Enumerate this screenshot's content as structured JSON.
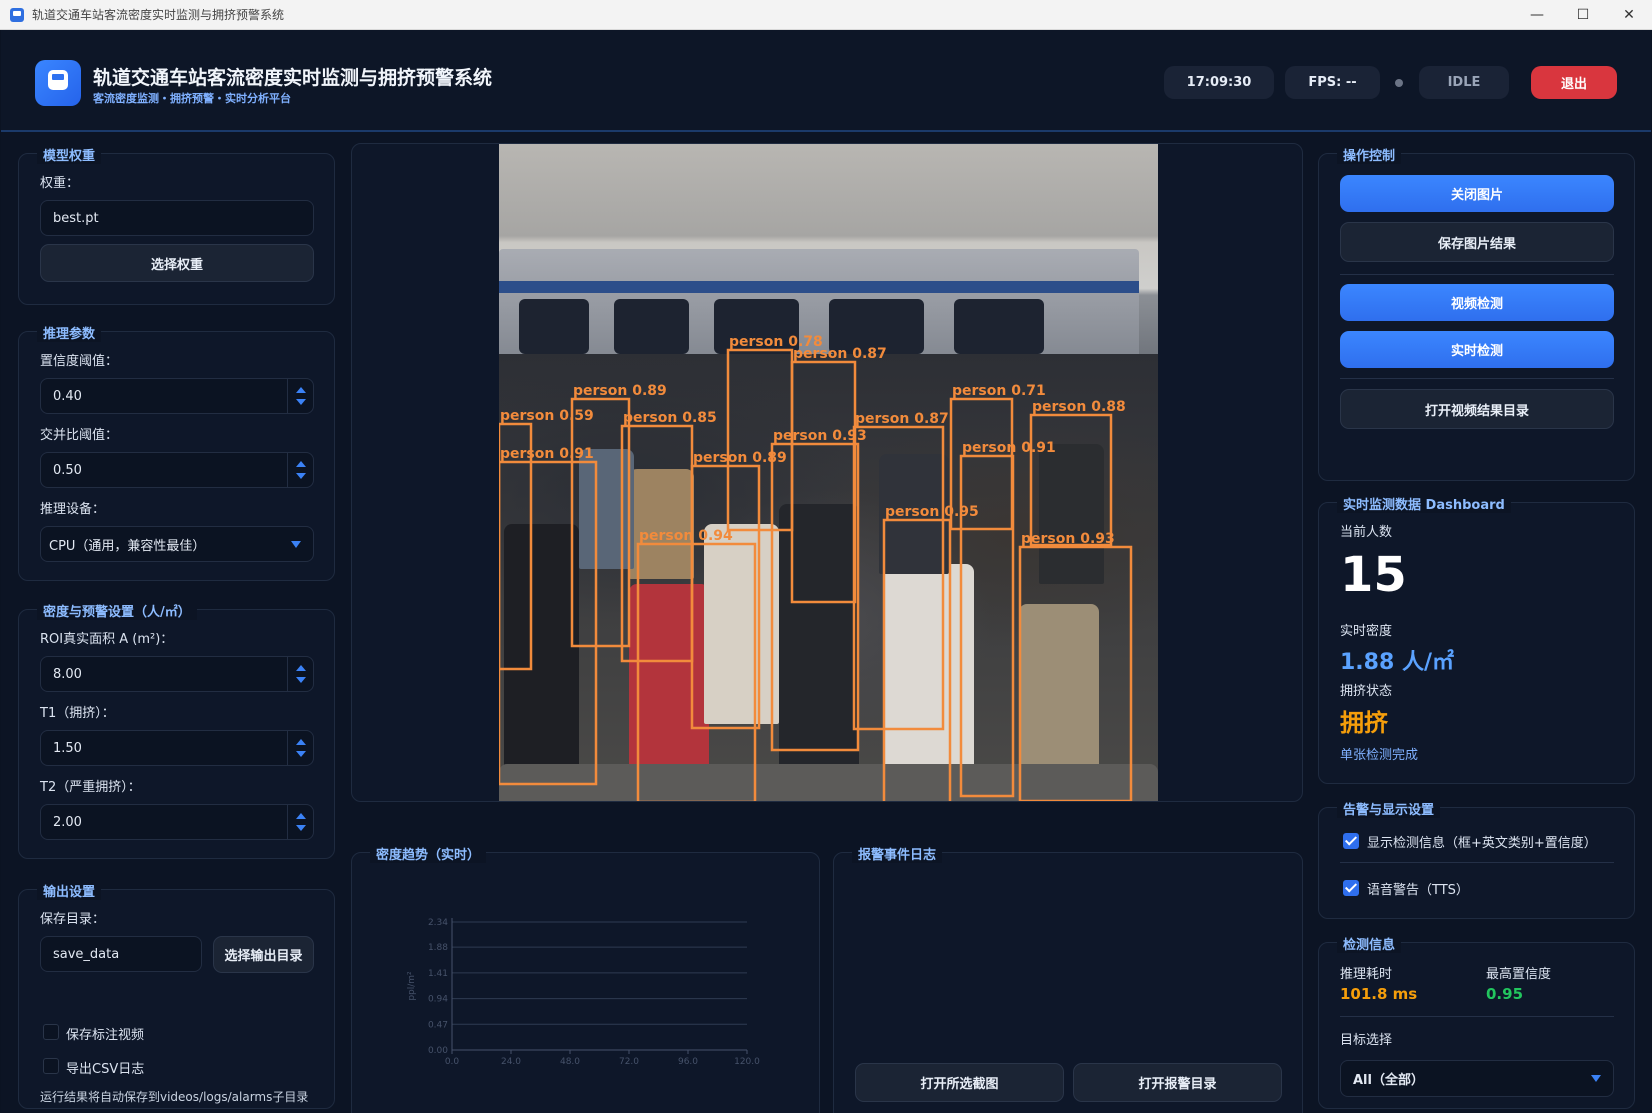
{
  "window": {
    "title": "轨道交通车站客流密度实时监测与拥挤预警系统"
  },
  "header": {
    "title": "轨道交通车站客流密度实时监测与拥挤预警系统",
    "subtitle": "客流密度监测・拥挤预警・实时分析平台",
    "time": "17:09:30",
    "fps": "FPS: --",
    "status": "IDLE",
    "exit_label": "退出"
  },
  "model": {
    "section": "模型权重",
    "weight_label": "权重：",
    "weight_value": "best.pt",
    "choose_label": "选择权重"
  },
  "inference": {
    "section": "推理参数",
    "conf_label": "置信度阈值：",
    "conf_value": "0.40",
    "iou_label": "交并比阈值：",
    "iou_value": "0.50",
    "device_label": "推理设备：",
    "device_value": "CPU（通用，兼容性最佳）"
  },
  "density": {
    "section": "密度与预警设置（人/㎡）",
    "roi_label": "ROI真实面积 A (m²)：",
    "roi_value": "8.00",
    "t1_label": "T1（拥挤）：",
    "t1_value": "1.50",
    "t2_label": "T2（严重拥挤）：",
    "t2_value": "2.00"
  },
  "output": {
    "section": "输出设置",
    "dir_label": "保存目录：",
    "dir_value": "save_data",
    "choose_dir_label": "选择输出目录",
    "save_video_label": "保存标注视频",
    "export_csv_label": "导出CSV日志",
    "note": "运行结果将自动保存到videos/logs/alarms子目录"
  },
  "detections": [
    {
      "label": "person 0.78"
    },
    {
      "label": "person 0.87"
    },
    {
      "label": "person 0.89"
    },
    {
      "label": "person 0.59"
    },
    {
      "label": "person 0.85"
    },
    {
      "label": "person 0.71"
    },
    {
      "label": "person 0.88"
    },
    {
      "label": "person 0.91"
    },
    {
      "label": "person 0.89"
    },
    {
      "label": "person 0.93"
    },
    {
      "label": "person 0.87"
    },
    {
      "label": "person 0.91"
    },
    {
      "label": "person 0.95"
    },
    {
      "label": "person 0.94"
    },
    {
      "label": "person 0.93"
    }
  ],
  "trend": {
    "section": "密度趋势（实时）",
    "chart_data": {
      "type": "line",
      "title": "",
      "xlabel": "",
      "ylabel": "ppl/m²",
      "x_ticks": [
        "0.0",
        "24.0",
        "48.0",
        "72.0",
        "96.0",
        "120.0"
      ],
      "y_ticks": [
        "0.00",
        "0.47",
        "0.94",
        "1.41",
        "1.88",
        "2.34"
      ],
      "xlim": [
        0,
        120
      ],
      "ylim": [
        0,
        2.34
      ],
      "series": [],
      "grid": true
    }
  },
  "alarm_log": {
    "section": "报警事件日志",
    "open_selected_label": "打开所选截图",
    "open_dir_label": "打开报警目录"
  },
  "controls": {
    "section": "操作控制",
    "close_image": "关闭图片",
    "save_result": "保存图片结果",
    "video_detect": "视频检测",
    "realtime_detect": "实时检测",
    "open_video_dir": "打开视频结果目录"
  },
  "dashboard": {
    "section": "实时监测数据 Dashboard",
    "count_label": "当前人数",
    "count_value": "15",
    "density_label": "实时密度",
    "density_value": "1.88 人/㎡",
    "status_label": "拥挤状态",
    "status_value": "拥挤",
    "status_note": "单张检测完成",
    "colors": {
      "density": "#5aa2ff",
      "status": "#f59e0b"
    }
  },
  "alerts": {
    "section": "告警与显示设置",
    "show_info_label": "显示检测信息（框+英文类别+置信度）",
    "tts_label": "语音警告（TTS）"
  },
  "detinfo": {
    "section": "检测信息",
    "time_label": "推理耗时",
    "time_value": "101.8 ms",
    "conf_label": "最高置信度",
    "conf_value": "0.95",
    "target_label": "目标选择",
    "target_value": "All（全部）",
    "colors": {
      "time": "#f59e0b",
      "conf": "#22c55e"
    }
  }
}
